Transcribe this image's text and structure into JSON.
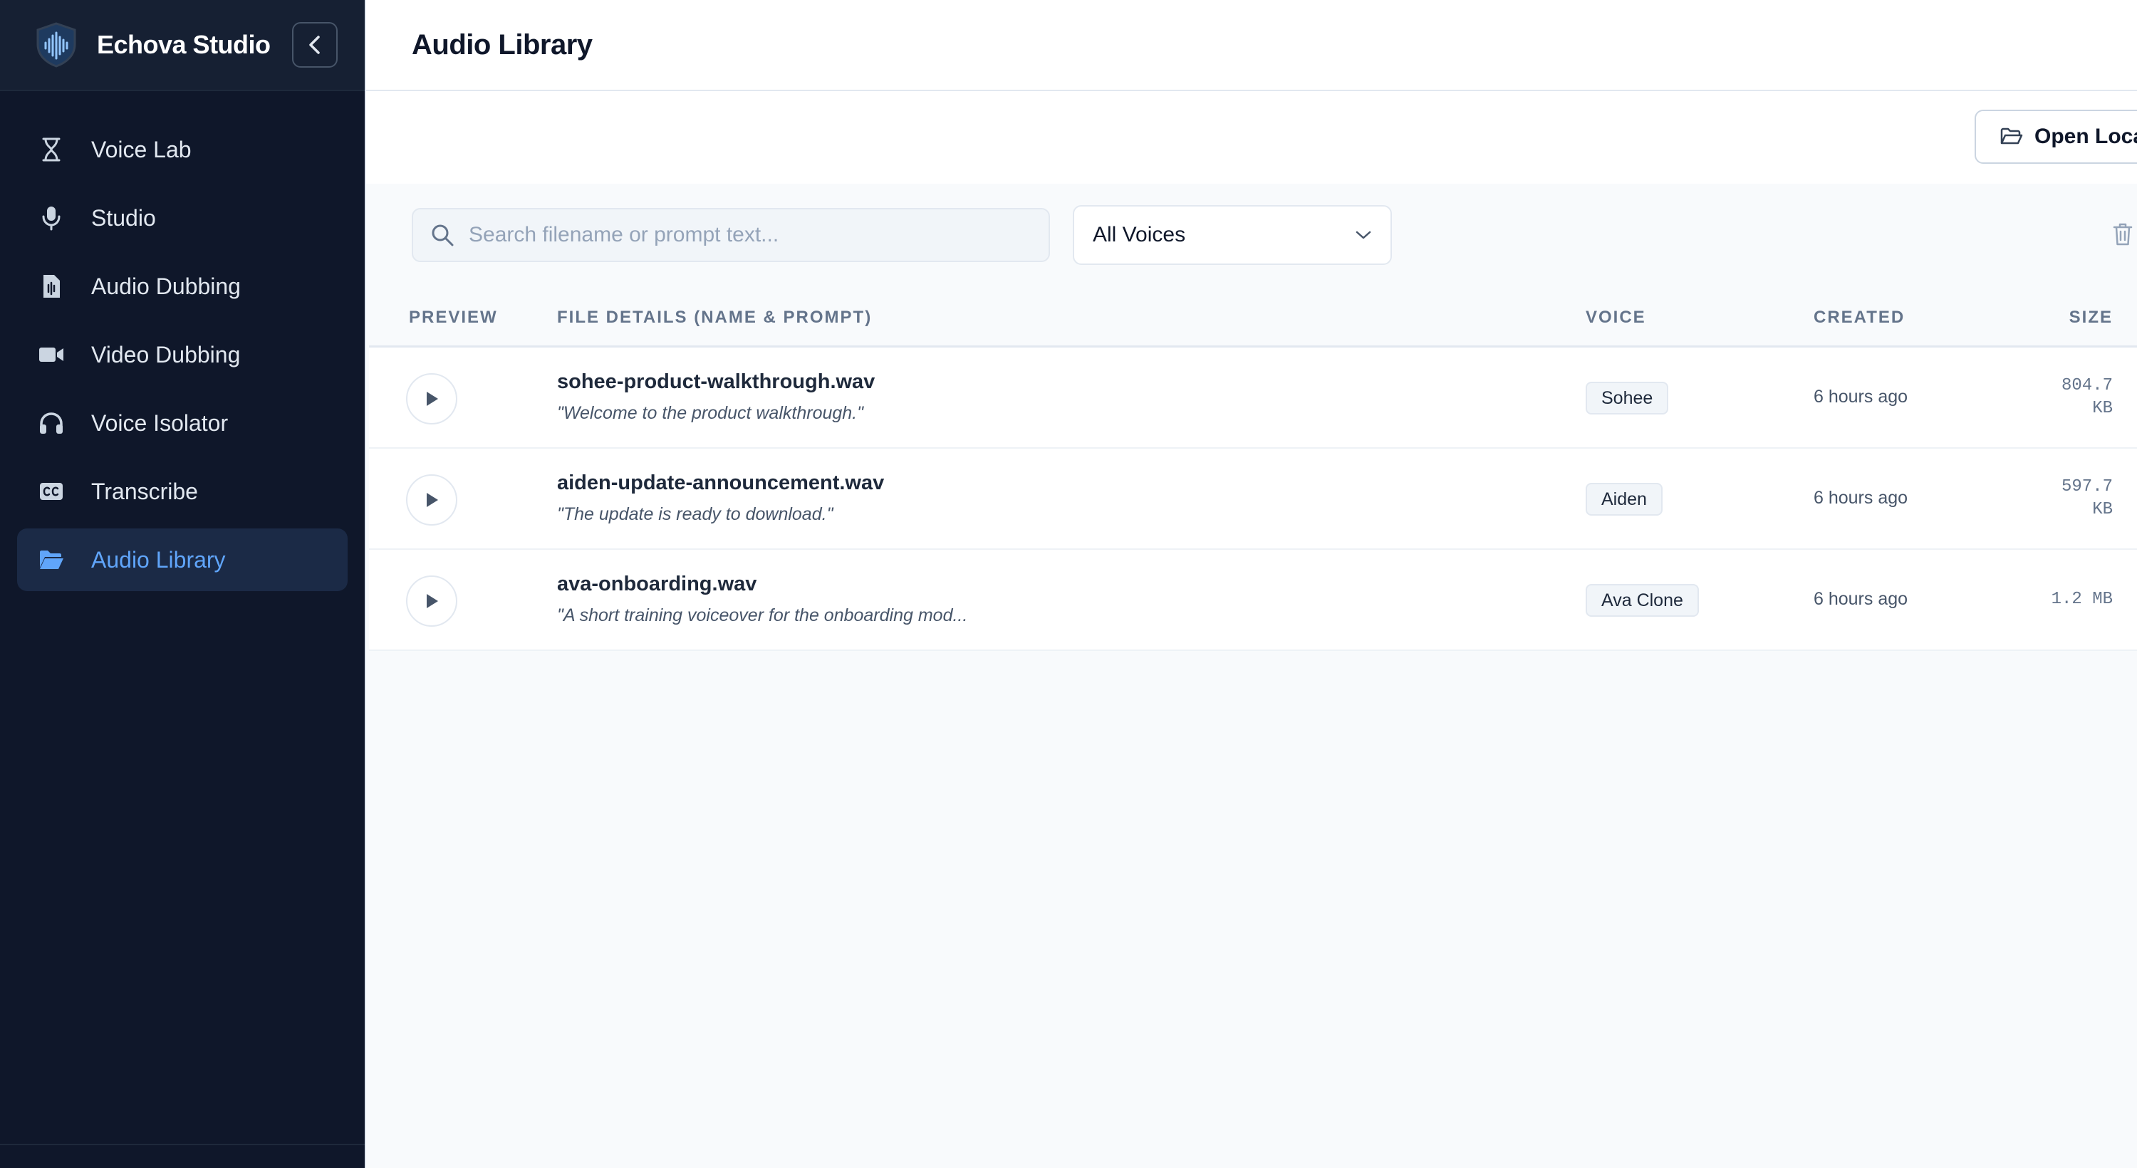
{
  "app": {
    "brand": "Echova Studio",
    "accent": "#60a5fa",
    "sidebar_bg": "#0f172a"
  },
  "sidebar": {
    "items": [
      {
        "label": "Voice Lab",
        "icon": "hourglass-icon",
        "active": false
      },
      {
        "label": "Studio",
        "icon": "microphone-icon",
        "active": false
      },
      {
        "label": "Audio Dubbing",
        "icon": "audio-file-icon",
        "active": false
      },
      {
        "label": "Video Dubbing",
        "icon": "video-camera-icon",
        "active": false
      },
      {
        "label": "Voice Isolator",
        "icon": "headphones-icon",
        "active": false
      },
      {
        "label": "Transcribe",
        "icon": "closed-captions-icon",
        "active": false
      },
      {
        "label": "Audio Library",
        "icon": "folder-open-icon",
        "active": true
      }
    ]
  },
  "header": {
    "title": "Audio Library"
  },
  "actions": {
    "open_local_label": "Open Loca"
  },
  "filters": {
    "search_placeholder": "Search filename or prompt text...",
    "search_value": "",
    "voice_selected": "All Voices"
  },
  "table": {
    "columns": {
      "preview": "PREVIEW",
      "details": "FILE DETAILS (NAME & PROMPT)",
      "voice": "VOICE",
      "created": "CREATED",
      "size": "SIZE"
    },
    "rows": [
      {
        "name": "sohee-product-walkthrough.wav",
        "prompt": "\"Welcome to the product walkthrough.\"",
        "voice": "Sohee",
        "created": "6 hours ago",
        "size_value": "804.7",
        "size_unit": "KB"
      },
      {
        "name": "aiden-update-announcement.wav",
        "prompt": "\"The update is ready to download.\"",
        "voice": "Aiden",
        "created": "6 hours ago",
        "size_value": "597.7",
        "size_unit": "KB"
      },
      {
        "name": "ava-onboarding.wav",
        "prompt": "\"A short training voiceover for the onboarding mod...",
        "voice": "Ava Clone",
        "created": "6 hours ago",
        "size_value": "1.2 MB",
        "size_unit": ""
      }
    ]
  }
}
